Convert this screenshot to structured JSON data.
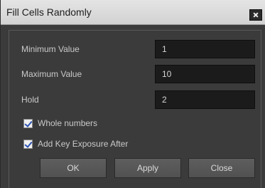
{
  "window": {
    "title": "Fill Cells Randomly"
  },
  "fields": {
    "minimum": {
      "label": "Minimum Value",
      "value": "1"
    },
    "maximum": {
      "label": "Maximum Value",
      "value": "10"
    },
    "hold": {
      "label": "Hold",
      "value": "2"
    }
  },
  "options": {
    "whole_numbers": {
      "label": "Whole numbers",
      "checked": true
    },
    "add_key_exposure": {
      "label": "Add Key Exposure After",
      "checked": true
    }
  },
  "buttons": {
    "ok": "OK",
    "apply": "Apply",
    "close": "Close"
  }
}
